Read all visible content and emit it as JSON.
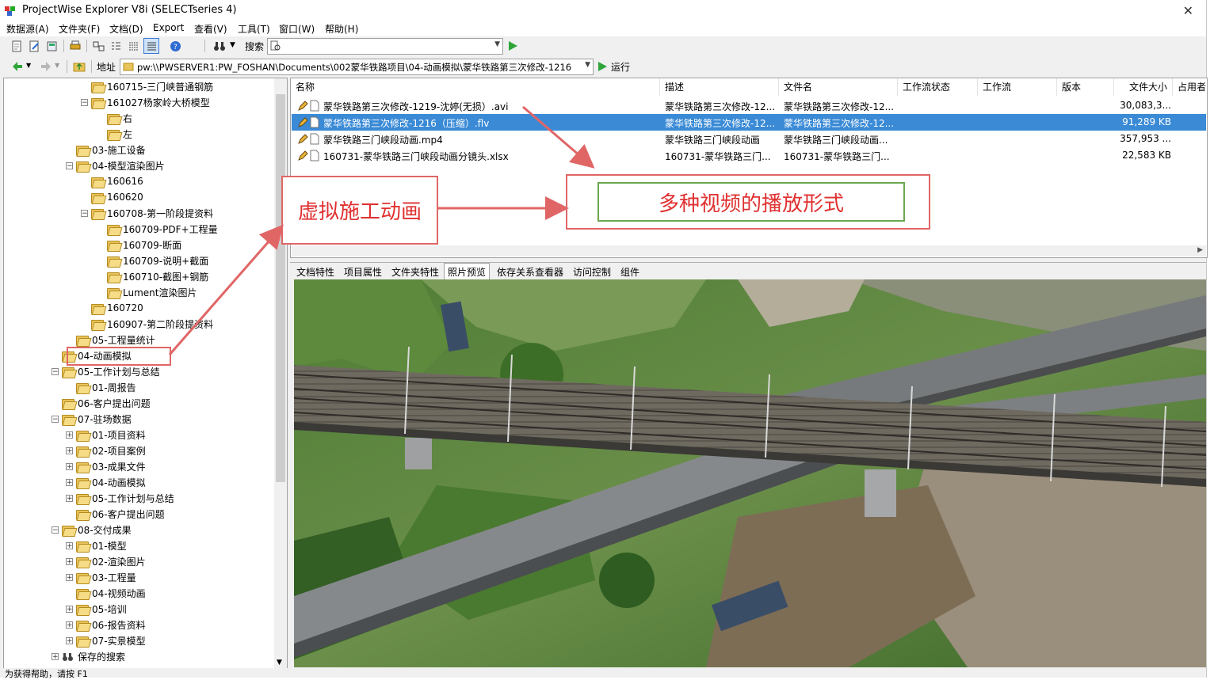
{
  "window": {
    "title": "ProjectWise Explorer V8i (SELECTseries 4)",
    "close_glyph": "✕"
  },
  "menu": [
    "数据源(A)",
    "文件夹(F)",
    "文档(D)",
    "Export",
    "查看(V)",
    "工具(T)",
    "窗口(W)",
    "帮助(H)"
  ],
  "toolbar": {
    "search_label": "搜索",
    "search_value": "",
    "address_label": "地址",
    "address_value": "pw:\\\\PWSERVER1:PW_FOSHAN\\Documents\\002蒙华铁路项目\\04-动画模拟\\蒙华铁路第三次修改-1216（",
    "run_label": "运行"
  },
  "tree": {
    "items": [
      {
        "label": "160715-三门峡普通钢筋",
        "expander": ""
      },
      {
        "label": "161027杨家岭大桥模型",
        "expander": "−"
      },
      {
        "label": "右",
        "expander": ""
      },
      {
        "label": "左",
        "expander": ""
      },
      {
        "label": "03-施工设备",
        "expander": ""
      },
      {
        "label": "04-模型渲染图片",
        "expander": "−"
      },
      {
        "label": "160616",
        "expander": ""
      },
      {
        "label": "160620",
        "expander": ""
      },
      {
        "label": "160708-第一阶段提资料",
        "expander": "−"
      },
      {
        "label": "160709-PDF+工程量",
        "expander": ""
      },
      {
        "label": "160709-断面",
        "expander": ""
      },
      {
        "label": "160709-说明+截面",
        "expander": ""
      },
      {
        "label": "160710-截图+钢筋",
        "expander": ""
      },
      {
        "label": "Lument渲染图片",
        "expander": ""
      },
      {
        "label": "160720",
        "expander": ""
      },
      {
        "label": "160907-第二阶段提资料",
        "expander": ""
      },
      {
        "label": "05-工程量统计",
        "expander": ""
      },
      {
        "label": "04-动画模拟",
        "expander": ""
      },
      {
        "label": "05-工作计划与总结",
        "expander": "−"
      },
      {
        "label": "01-周报告",
        "expander": ""
      },
      {
        "label": "06-客户提出问题",
        "expander": ""
      },
      {
        "label": "07-驻场数据",
        "expander": "−"
      },
      {
        "label": "01-项目资料",
        "expander": "+"
      },
      {
        "label": "02-项目案例",
        "expander": "+"
      },
      {
        "label": "03-成果文件",
        "expander": "+"
      },
      {
        "label": "04-动画模拟",
        "expander": "+"
      },
      {
        "label": "05-工作计划与总结",
        "expander": "+"
      },
      {
        "label": "06-客户提出问题",
        "expander": ""
      },
      {
        "label": "08-交付成果",
        "expander": "−"
      },
      {
        "label": "01-模型",
        "expander": "+"
      },
      {
        "label": "02-渲染图片",
        "expander": "+"
      },
      {
        "label": "03-工程量",
        "expander": "+"
      },
      {
        "label": "04-视频动画",
        "expander": ""
      },
      {
        "label": "05-培训",
        "expander": "+"
      },
      {
        "label": "06-报告资料",
        "expander": "+"
      },
      {
        "label": "07-实景模型",
        "expander": "+"
      },
      {
        "label": "保存的搜索",
        "expander": "+"
      }
    ]
  },
  "filelist": {
    "columns": [
      "名称",
      "描述",
      "文件名",
      "工作流状态",
      "工作流",
      "版本",
      "文件大小",
      "占用者"
    ],
    "rows": [
      {
        "name": "蒙华铁路第三次修改-1219-沈婷(无损）.avi",
        "desc": "蒙华铁路第三次修改-12...",
        "file": "蒙华铁路第三次修改-12...",
        "size": "30,083,3...",
        "selected": false
      },
      {
        "name": "蒙华铁路第三次修改-1216（压缩）.flv",
        "desc": "蒙华铁路第三次修改-12...",
        "file": "蒙华铁路第三次修改-12...",
        "size": "91,289 KB",
        "selected": true
      },
      {
        "name": "蒙华铁路三门峡段动画.mp4",
        "desc": "蒙华铁路三门峡段动画",
        "file": "蒙华铁路三门峡段动画...",
        "size": "357,953 ...",
        "selected": false
      },
      {
        "name": "160731-蒙华铁路三门峡段动画分镜头.xlsx",
        "desc": "160731-蒙华铁路三门...",
        "file": "160731-蒙华铁路三门...",
        "size": "22,583 KB",
        "selected": false
      }
    ]
  },
  "preview_tabs": [
    "文档特性",
    "项目属性",
    "文件夹特性",
    "照片预览",
    "依存关系查看器",
    "访问控制",
    "组件"
  ],
  "annotations": {
    "left_callout": "虚拟施工动画",
    "right_callout": "多种视频的播放形式"
  },
  "statusbar": {
    "text": "为获得帮助，请按 F1"
  },
  "colors": {
    "selection": "#3a8ad6",
    "callout_border": "#e06666",
    "callout_text": "#e03030",
    "green_box": "#6aa84f"
  }
}
